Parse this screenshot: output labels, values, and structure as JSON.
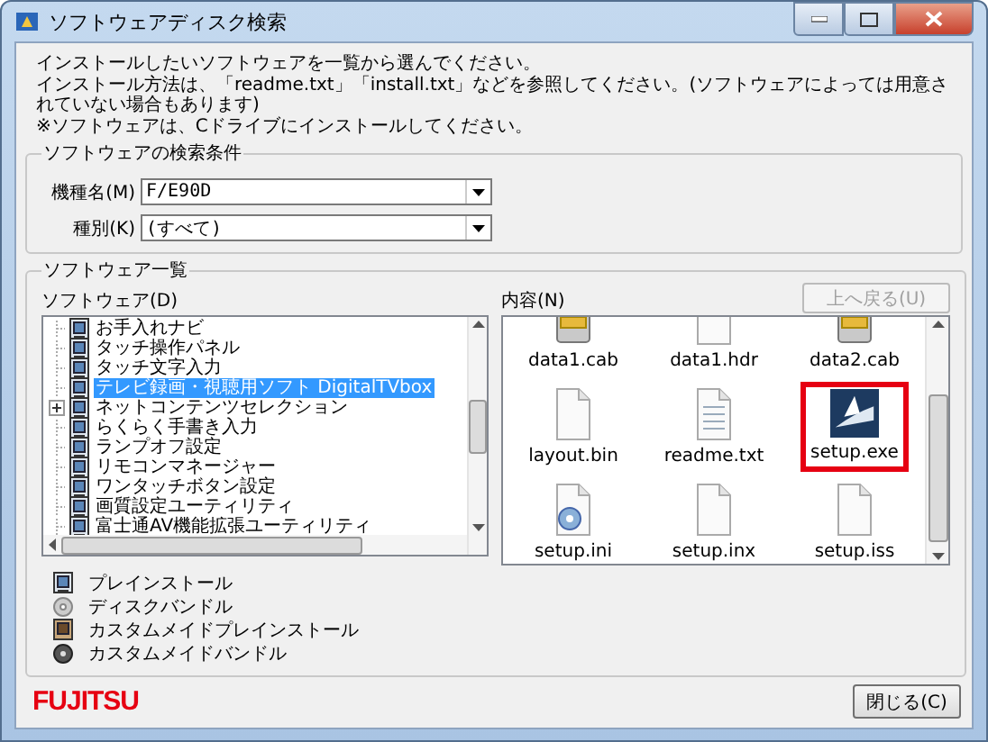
{
  "window": {
    "title": "ソフトウェアディスク検索"
  },
  "instructions": [
    "インストールしたいソフトウェアを一覧から選んでください。",
    "インストール方法は、「readme.txt」「install.txt」などを参照してください。(ソフトウェアによっては用意されていない場合もあります)",
    "※ソフトウェアは、Cドライブにインストールしてください。"
  ],
  "search_group": {
    "title": "ソフトウェアの検索条件",
    "fields": [
      {
        "label": "機種名(M)",
        "value": "F/E90D"
      },
      {
        "label": "種別(K)",
        "value": "(すべて)"
      }
    ]
  },
  "list_group": {
    "title": "ソフトウェア一覧",
    "tree_label": "ソフトウェア(D)",
    "contents_label": "内容(N)",
    "up_button": {
      "label": "上へ戻る(U)",
      "disabled": true
    },
    "tree": [
      {
        "label": "お手入れナビ",
        "selected": false,
        "collapsed": false
      },
      {
        "label": "タッチ操作パネル",
        "selected": false,
        "collapsed": false
      },
      {
        "label": "タッチ文字入力",
        "selected": false,
        "collapsed": false
      },
      {
        "label": "テレビ録画・視聴用ソフト DigitalTVbox",
        "selected": true,
        "collapsed": false
      },
      {
        "label": "ネットコンテンツセレクション",
        "selected": false,
        "collapsed": true
      },
      {
        "label": "らくらく手書き入力",
        "selected": false,
        "collapsed": false
      },
      {
        "label": "ランプオフ設定",
        "selected": false,
        "collapsed": false
      },
      {
        "label": "リモコンマネージャー",
        "selected": false,
        "collapsed": false
      },
      {
        "label": "ワンタッチボタン設定",
        "selected": false,
        "collapsed": false
      },
      {
        "label": "画質設定ユーティリティ",
        "selected": false,
        "collapsed": false
      },
      {
        "label": "富士通AV機能拡張ユーティリティ",
        "selected": false,
        "collapsed": false
      }
    ],
    "files": [
      {
        "name": "data1.cab",
        "kind": "cab",
        "marked": false
      },
      {
        "name": "data1.hdr",
        "kind": "file",
        "marked": false
      },
      {
        "name": "data2.cab",
        "kind": "cab",
        "marked": false
      },
      {
        "name": "layout.bin",
        "kind": "file",
        "marked": false
      },
      {
        "name": "readme.txt",
        "kind": "text",
        "marked": false
      },
      {
        "name": "setup.exe",
        "kind": "exe",
        "marked": true
      },
      {
        "name": "setup.ini",
        "kind": "ini",
        "marked": false
      },
      {
        "name": "setup.inx",
        "kind": "file",
        "marked": false
      },
      {
        "name": "setup.iss",
        "kind": "file",
        "marked": false
      }
    ],
    "legend": [
      {
        "label": "プレインストール",
        "kind": "preinstall"
      },
      {
        "label": "ディスクバンドル",
        "kind": "bundle"
      },
      {
        "label": "カスタムメイドプレインストール",
        "kind": "custom-preinstall"
      },
      {
        "label": "カスタムメイドバンドル",
        "kind": "custom-bundle"
      }
    ]
  },
  "footer": {
    "logo": "FUJITSU",
    "close_button": "閉じる(C)"
  }
}
